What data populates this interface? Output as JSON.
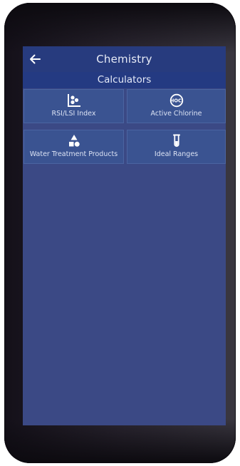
{
  "header": {
    "title": "Chemistry",
    "back_icon": "arrow-left-icon"
  },
  "section": {
    "title": "Calculators"
  },
  "calculators": [
    {
      "label": "RSI/LSI Index",
      "icon": "scatter-chart-icon"
    },
    {
      "label": "Active Chlorine",
      "icon": "chlorine-hocl-icon",
      "icon_text": "HOCl"
    },
    {
      "label": "Water Treatment Products",
      "icon": "shapes-icon"
    },
    {
      "label": "Ideal Ranges",
      "icon": "test-tube-icon"
    }
  ],
  "colors": {
    "app_bar": "#273b7e",
    "section_header": "#243a82",
    "tile": "#3a5391",
    "screen_background": "#3b4985",
    "text": "#e8ecf7"
  }
}
